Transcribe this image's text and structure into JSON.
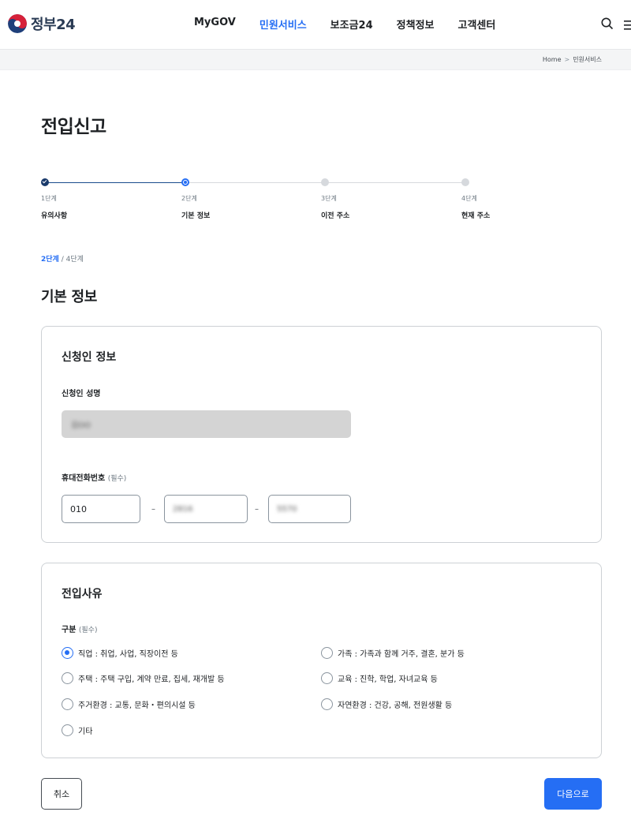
{
  "header": {
    "logo_text": "정부24",
    "nav": [
      "MyGOV",
      "민원서비스",
      "보조금24",
      "정책정보",
      "고객센터"
    ],
    "active_nav_index": 1,
    "search_icon": "search-icon",
    "menu_icon": "hamburger-menu-icon"
  },
  "breadcrumb": {
    "home": "Home",
    "sep": ">",
    "current": "민원서비스"
  },
  "page": {
    "title": "전입신고"
  },
  "stepper": {
    "steps": [
      {
        "num": "1단계",
        "label": "유의사항",
        "state": "done"
      },
      {
        "num": "2단계",
        "label": "기본 정보",
        "state": "current"
      },
      {
        "num": "3단계",
        "label": "이전 주소",
        "state": "todo"
      },
      {
        "num": "4단계",
        "label": "현재 주소",
        "state": "todo"
      }
    ],
    "progress_current": "2단계",
    "progress_total": "/ 4단계"
  },
  "section": {
    "title": "기본 정보"
  },
  "applicant": {
    "title": "신청인 정보",
    "name_label": "신청인 성명",
    "name_value": "김OO",
    "phone_label": "휴대전화번호",
    "required": "(필수)",
    "phone_dash": "–",
    "phone": [
      "010",
      "2816",
      "5570"
    ]
  },
  "reason": {
    "title": "전입사유",
    "category_label": "구분",
    "required": "(필수)",
    "options": [
      "직업 : 취업, 사업, 직장이전 등",
      "가족 : 가족과 함께 거주, 결혼, 분가 등",
      "주택 : 주택 구입, 계약 만료, 집세, 재개발 등",
      "교육 : 진학, 학업, 자녀교육 등",
      "주거환경 : 교통, 문화・편의시설 등",
      "자연환경 : 건강, 공해, 전원생활 등",
      "기타"
    ],
    "selected_index": 0
  },
  "buttons": {
    "cancel": "취소",
    "next": "다음으로"
  },
  "colors": {
    "primary": "#256ef4",
    "done": "#1a3a6b",
    "border": "#cdd1d5"
  }
}
